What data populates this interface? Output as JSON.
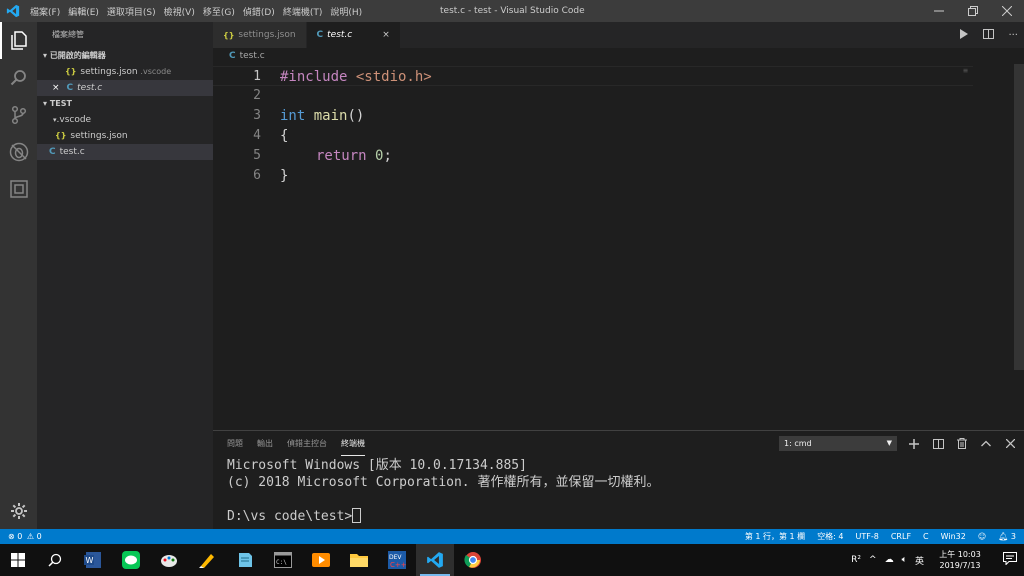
{
  "titlebar": {
    "menu": [
      "檔案(F)",
      "編輯(E)",
      "選取項目(S)",
      "檢視(V)",
      "移至(G)",
      "偵錯(D)",
      "終端機(T)",
      "說明(H)"
    ],
    "title": "test.c - test - Visual Studio Code"
  },
  "sidebar": {
    "title": "檔案總管",
    "open_editors_header": "已開啟的編輯器",
    "open_editors": [
      {
        "name": "settings.json",
        "detail": ".vscode"
      },
      {
        "name": "test.c",
        "close": "×"
      }
    ],
    "folder_header": "TEST",
    "tree": [
      {
        "name": ".vscode"
      },
      {
        "name": "settings.json"
      },
      {
        "name": "test.c"
      }
    ]
  },
  "tabs": [
    {
      "label": "settings.json"
    },
    {
      "label": "test.c",
      "close": "×"
    }
  ],
  "breadcrumb": "test.c",
  "code": {
    "line_numbers": [
      "1",
      "2",
      "3",
      "4",
      "5",
      "6"
    ],
    "l1_directive": "#include ",
    "l1_header": "<stdio.h>",
    "l3_type": "int",
    "l3_fn": "main",
    "l3_rest": "()",
    "l4": "{",
    "l5_kw": "return",
    "l5_num": "0",
    "l5_end": ";",
    "l6": "}"
  },
  "panel": {
    "tabs": [
      "問題",
      "輸出",
      "偵錯主控台",
      "終端機"
    ],
    "terminal_select": "1: cmd",
    "terminal_lines": [
      "Microsoft Windows [版本 10.0.17134.885]",
      "(c) 2018 Microsoft Corporation. 著作權所有，並保留一切權利。",
      "",
      "D:\\vs code\\test>"
    ]
  },
  "statusbar": {
    "errors": "0",
    "warnings": "0",
    "position": "第 1 行，第 1 欄",
    "spaces": "空格: 4",
    "encoding": "UTF-8",
    "eol": "CRLF",
    "language": "C",
    "platform": "Win32",
    "notifications": "3"
  },
  "taskbar": {
    "ime": "英",
    "time": "上午 10:03",
    "date": "2019/7/13"
  },
  "colors": {
    "accent": "#007acc",
    "vscode_blue": "#23a9f2"
  }
}
